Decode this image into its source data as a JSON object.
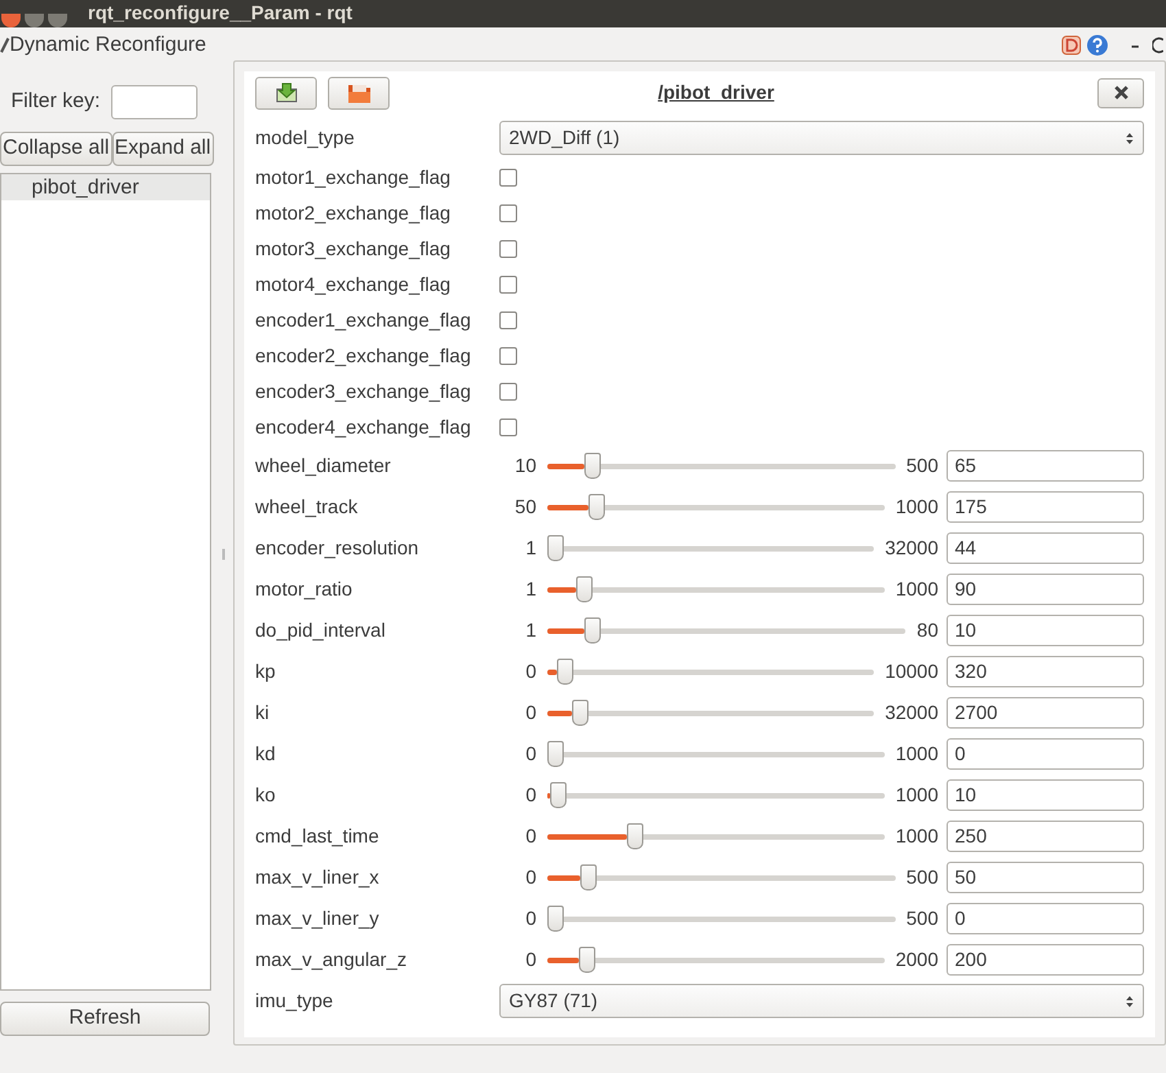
{
  "window": {
    "title": "rqt_reconfigure__Param - rqt"
  },
  "plugin_title": "Dynamic Reconfigure",
  "filter": {
    "label": "Filter key:"
  },
  "buttons": [
    "Collapse all",
    "Expand all"
  ],
  "tree": [
    {
      "label": "pibot_driver",
      "selected": true
    }
  ],
  "refresh": "Refresh",
  "node": {
    "name": "/pibot_driver",
    "params": [
      {
        "kind": "enum",
        "name": "model_type",
        "value": "2WD_Diff (1)"
      },
      {
        "kind": "bool",
        "name": "motor1_exchange_flag",
        "checked": false
      },
      {
        "kind": "bool",
        "name": "motor2_exchange_flag",
        "checked": false
      },
      {
        "kind": "bool",
        "name": "motor3_exchange_flag",
        "checked": false
      },
      {
        "kind": "bool",
        "name": "motor4_exchange_flag",
        "checked": false
      },
      {
        "kind": "bool",
        "name": "encoder1_exchange_flag",
        "checked": false
      },
      {
        "kind": "bool",
        "name": "encoder2_exchange_flag",
        "checked": false
      },
      {
        "kind": "bool",
        "name": "encoder3_exchange_flag",
        "checked": false
      },
      {
        "kind": "bool",
        "name": "encoder4_exchange_flag",
        "checked": false
      },
      {
        "kind": "slider",
        "name": "wheel_diameter",
        "min": "10",
        "max": "500",
        "value": "65",
        "level": 0.11
      },
      {
        "kind": "slider",
        "name": "wheel_track",
        "min": "50",
        "max": "1000",
        "value": "175",
        "level": 0.13
      },
      {
        "kind": "slider",
        "name": "encoder_resolution",
        "min": "1",
        "max": "32000",
        "value": "44",
        "level": 0.0
      },
      {
        "kind": "slider",
        "name": "motor_ratio",
        "min": "1",
        "max": "1000",
        "value": "90",
        "level": 0.09
      },
      {
        "kind": "slider",
        "name": "do_pid_interval",
        "min": "1",
        "max": "80",
        "value": "10",
        "level": 0.11
      },
      {
        "kind": "slider",
        "name": "kp",
        "min": "0",
        "max": "10000",
        "value": "320",
        "level": 0.03
      },
      {
        "kind": "slider",
        "name": "ki",
        "min": "0",
        "max": "32000",
        "value": "2700",
        "level": 0.08
      },
      {
        "kind": "slider",
        "name": "kd",
        "min": "0",
        "max": "1000",
        "value": "0",
        "level": 0.0
      },
      {
        "kind": "slider",
        "name": "ko",
        "min": "0",
        "max": "1000",
        "value": "10",
        "level": 0.01
      },
      {
        "kind": "slider",
        "name": "cmd_last_time",
        "min": "0",
        "max": "1000",
        "value": "250",
        "level": 0.25
      },
      {
        "kind": "slider",
        "name": "max_v_liner_x",
        "min": "0",
        "max": "500",
        "value": "50",
        "level": 0.1
      },
      {
        "kind": "slider",
        "name": "max_v_liner_y",
        "min": "0",
        "max": "500",
        "value": "0",
        "level": 0.0
      },
      {
        "kind": "slider",
        "name": "max_v_angular_z",
        "min": "0",
        "max": "2000",
        "value": "200",
        "level": 0.1
      },
      {
        "kind": "enum",
        "name": "imu_type",
        "value": "GY87 (71)"
      }
    ]
  }
}
